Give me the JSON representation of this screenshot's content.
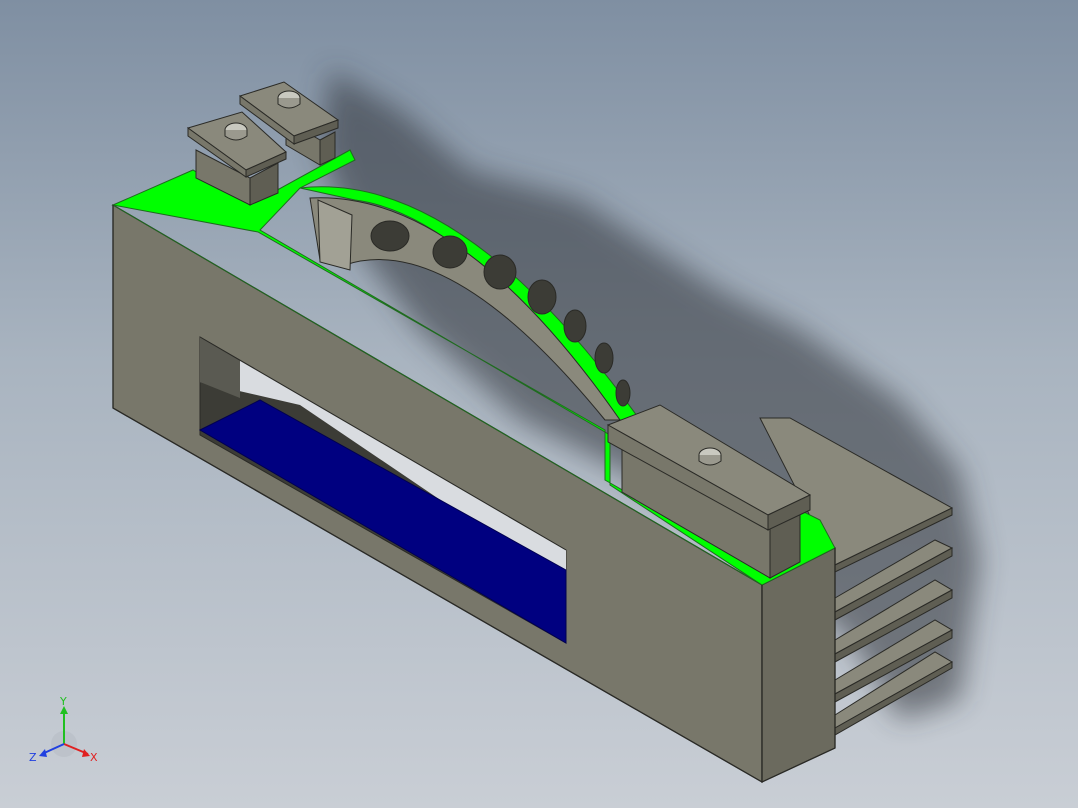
{
  "viewport": {
    "background_top": "#7f8fa2",
    "background_bottom": "#c9ced5"
  },
  "model": {
    "body_color": "#78776a",
    "body_light": "#8a897c",
    "body_dark": "#5f5e53",
    "section_color": "#00ff00",
    "window_fill": "#000080",
    "edge_color": "#2a2a26"
  },
  "triad": {
    "x_label": "X",
    "y_label": "Y",
    "z_label": "Z",
    "x_color": "#e02020",
    "y_color": "#20c020",
    "z_color": "#2040e0"
  }
}
